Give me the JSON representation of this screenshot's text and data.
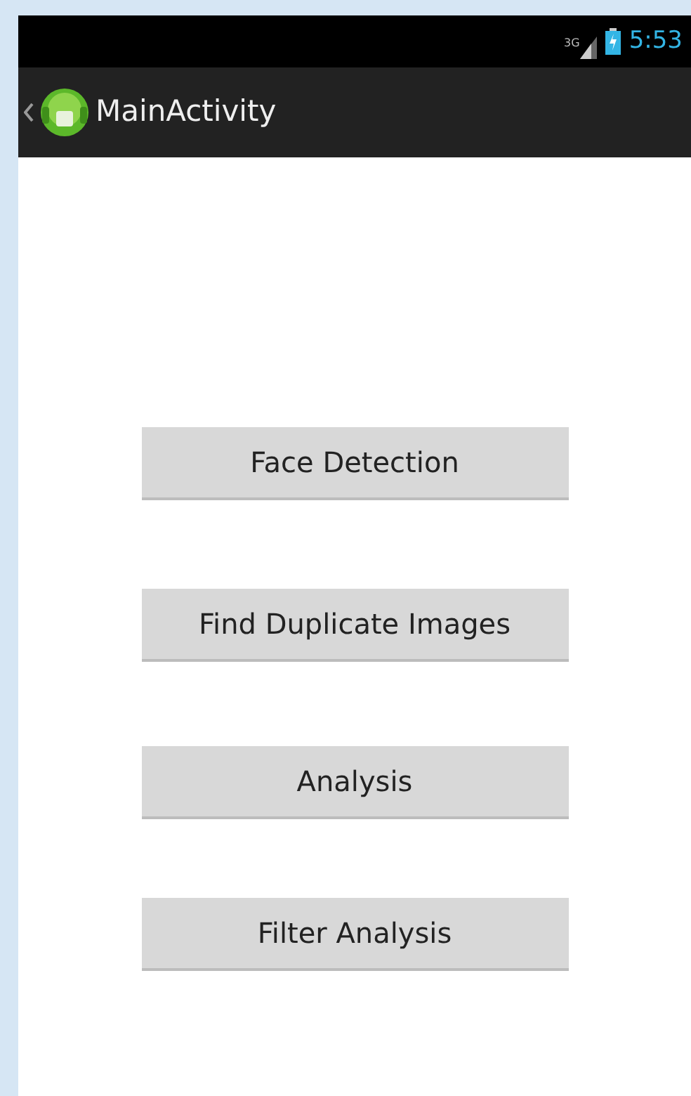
{
  "status_bar": {
    "network": "3G",
    "time": "5:53"
  },
  "action_bar": {
    "title": "MainActivity"
  },
  "buttons": [
    {
      "label": "Face Detection"
    },
    {
      "label": "Find Duplicate Images"
    },
    {
      "label": "Analysis"
    },
    {
      "label": "Filter Analysis"
    }
  ]
}
